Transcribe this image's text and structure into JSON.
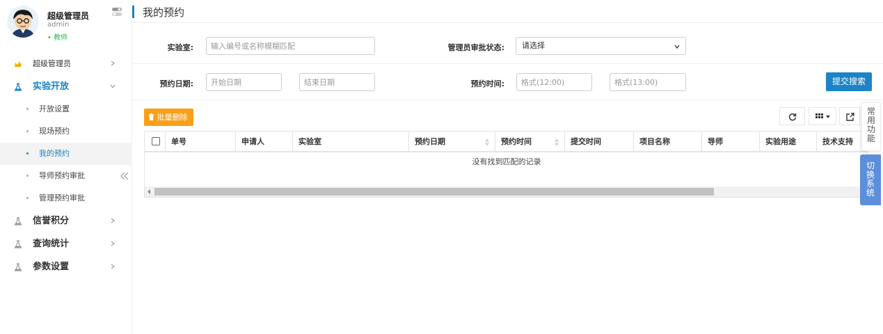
{
  "user": {
    "name": "超级管理员",
    "login": "admin",
    "role": "• 教师"
  },
  "menu": {
    "items": [
      {
        "label": "超级管理员"
      },
      {
        "label": "实验开放"
      },
      {
        "label": "信誉积分"
      },
      {
        "label": "查询统计"
      },
      {
        "label": "参数设置"
      }
    ],
    "sub": [
      {
        "label": "开放设置"
      },
      {
        "label": "现场预约"
      },
      {
        "label": "我的预约"
      },
      {
        "label": "导师预约审批"
      },
      {
        "label": "管理预约审批"
      }
    ]
  },
  "page": {
    "title": "我的预约"
  },
  "form": {
    "lab_label": "实验室:",
    "lab_placeholder": "输入编号或名称模糊匹配",
    "status_label": "管理员审批状态:",
    "status_value": "请选择",
    "date_label": "预约日期:",
    "start_placeholder": "开始日期",
    "end_placeholder": "结束日期",
    "time_label": "预约时间:",
    "time_start_placeholder": "格式(12:00)",
    "time_end_placeholder": "格式(13:00)",
    "submit_label": "提交搜索"
  },
  "toolbar": {
    "delete_label": "批量删除"
  },
  "table": {
    "columns": [
      "单号",
      "申请人",
      "实验室",
      "预约日期",
      "预约时间",
      "提交时间",
      "项目名称",
      "导师",
      "实验用途",
      "技术支持"
    ],
    "empty_text": "没有找到匹配的记录"
  },
  "float": {
    "common": "常用功能",
    "switch": "切换系统"
  },
  "colors": {
    "primary": "#1c84c6",
    "warning": "#f8a01a",
    "float_blue": "#5b8fd9",
    "role_green": "#2eb85c"
  },
  "icons": [
    "avatar",
    "toggle-icon",
    "crown-icon",
    "flask-icon",
    "chevron-right-icon",
    "chevron-down-icon",
    "double-left-icon",
    "refresh-icon",
    "grid-icon",
    "export-icon",
    "trash-icon",
    "sort-icon"
  ]
}
